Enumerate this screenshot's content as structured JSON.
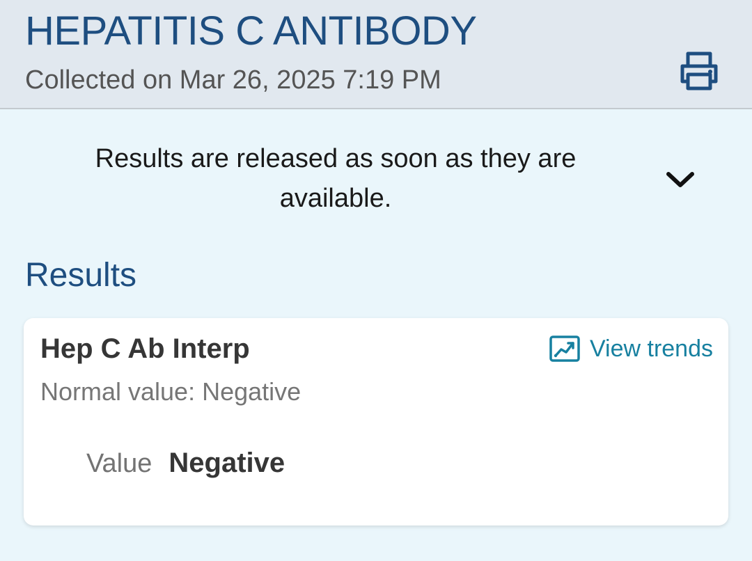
{
  "header": {
    "title": "HEPATITIS C ANTIBODY",
    "collected": "Collected on Mar 26, 2025 7:19 PM",
    "print_icon": "printer-icon"
  },
  "notice": {
    "text": "Results are released as soon as they are available.",
    "toggle_icon": "chevron-down-icon"
  },
  "results": {
    "section_title": "Results",
    "items": [
      {
        "name": "Hep C Ab Interp",
        "normal_value": "Normal value: Negative",
        "trends_label": "View trends",
        "trends_icon": "trend-chart-icon",
        "value_label": "Value",
        "value": "Negative"
      }
    ]
  },
  "colors": {
    "header_bg": "#e1e8ef",
    "page_bg": "#eaf6fb",
    "title_blue": "#1e4e80",
    "link_teal": "#1780a0",
    "card_bg": "#ffffff"
  }
}
